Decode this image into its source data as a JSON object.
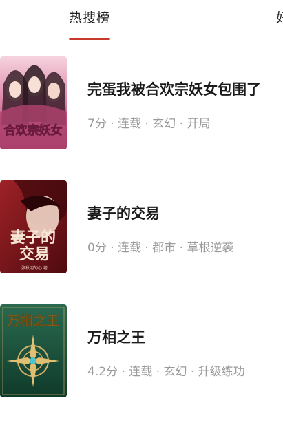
{
  "tabs": {
    "active_label": "热搜榜",
    "next_label_partial": "好"
  },
  "books": [
    {
      "title": "完蛋我被合欢宗妖女包围了",
      "meta": "7分 · 连载 · 玄幻 · 开局",
      "cover_text": "合欢宗妖女",
      "cover_colors": [
        "#f3c9d6",
        "#c0548a",
        "#7a2f5a"
      ]
    },
    {
      "title": "妻子的交易",
      "meta": "0分 · 连载 · 都市 · 草根逆袭",
      "cover_text_1": "妻子的",
      "cover_text_2": "交易",
      "cover_author": "张秋明的心 著",
      "cover_colors": [
        "#8e1c1f",
        "#5a0d12",
        "#f4d9c8"
      ]
    },
    {
      "title": "万相之王",
      "meta": "4.2分 · 连载 · 玄幻 · 升级练功",
      "cover_text": "万相之王",
      "cover_colors": [
        "#1f5a44",
        "#103a2a",
        "#d9b86a"
      ]
    }
  ]
}
